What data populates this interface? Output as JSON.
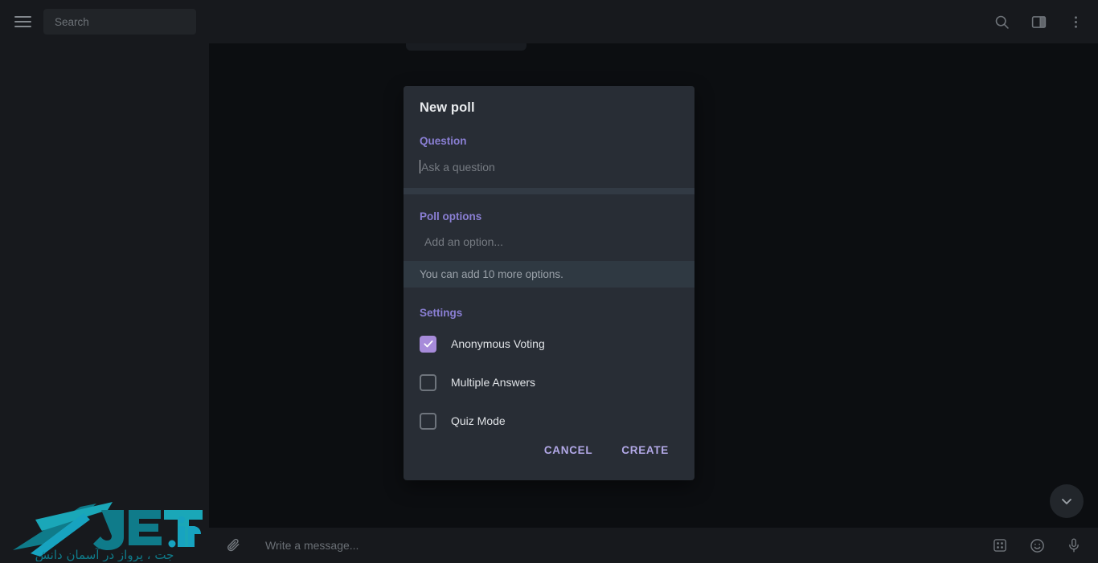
{
  "topbar": {
    "menu_icon": "hamburger-icon",
    "search": {
      "placeholder": "Search",
      "value": ""
    },
    "icons": [
      {
        "name": "search-icon",
        "label": "Search"
      },
      {
        "name": "sidebar-toggle-icon",
        "label": "Toggle panel"
      },
      {
        "name": "more-vertical-icon",
        "label": "More options"
      }
    ]
  },
  "composer": {
    "attach_icon": "paperclip-icon",
    "placeholder": "Write a message...",
    "value": "",
    "icons": [
      {
        "name": "apps-grid-icon",
        "label": "Apps"
      },
      {
        "name": "emoji-icon",
        "label": "Emoji"
      },
      {
        "name": "microphone-icon",
        "label": "Voice message"
      }
    ]
  },
  "chat": {
    "scroll_down_button": "scroll-to-bottom-button"
  },
  "watermark": {
    "brand": "JET",
    "tld": ".ir",
    "tagline": "جت ، پرواز در آسمان دانش"
  },
  "dialog": {
    "title": "New poll",
    "question": {
      "label": "Question",
      "placeholder": "Ask a question",
      "value": ""
    },
    "options": {
      "label": "Poll options",
      "placeholder": "Add an option...",
      "value": "",
      "hint": "You can add 10 more options."
    },
    "settings": {
      "label": "Settings",
      "items": [
        {
          "label": "Anonymous Voting",
          "checked": true
        },
        {
          "label": "Multiple Answers",
          "checked": false
        },
        {
          "label": "Quiz Mode",
          "checked": false
        }
      ]
    },
    "buttons": {
      "cancel": "CANCEL",
      "create": "CREATE"
    }
  },
  "colors": {
    "accent_purple": "#8a7fd4",
    "checkbox_on": "#a78bda",
    "button_text": "#b3a9e8",
    "dialog_bg": "#282d35",
    "divider": "#323a44",
    "hint_bg": "#2f3942",
    "app_bg": "#0c0e11",
    "panel_bg": "#17191d",
    "logo_teal": "#1aa7b8",
    "logo_dark_teal": "#10707e"
  }
}
